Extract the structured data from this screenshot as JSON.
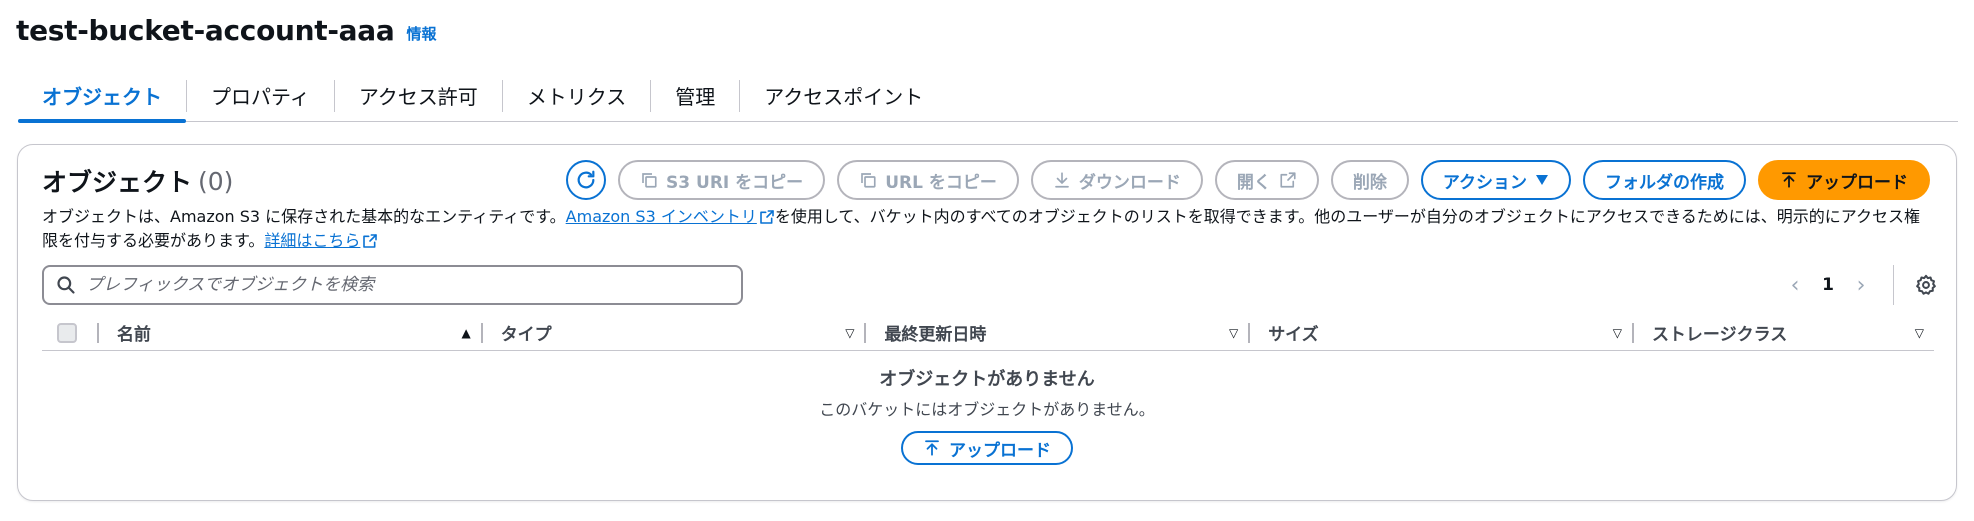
{
  "header": {
    "bucket_name": "test-bucket-account-aaa",
    "info_label": "情報"
  },
  "tabs": [
    {
      "label": "オブジェクト",
      "active": true
    },
    {
      "label": "プロパティ",
      "active": false
    },
    {
      "label": "アクセス許可",
      "active": false
    },
    {
      "label": "メトリクス",
      "active": false
    },
    {
      "label": "管理",
      "active": false
    },
    {
      "label": "アクセスポイント",
      "active": false
    }
  ],
  "panel": {
    "title": "オブジェクト",
    "count": "(0)",
    "actions": {
      "refresh_icon": "refresh-icon",
      "copy_s3_uri": "S3 URI をコピー",
      "copy_url": "URL をコピー",
      "download": "ダウンロード",
      "open": "開く",
      "delete": "削除",
      "actions": "アクション",
      "create_folder": "フォルダの作成",
      "upload": "アップロード"
    },
    "description": {
      "part1": "オブジェクトは、Amazon S3 に保存された基本的なエンティティです。",
      "link1": "Amazon S3 インベントリ",
      "part2": "を使用して、バケット内のすべてのオブジェクトのリストを取得できます。他のユーザーが自分のオブジェクトにアクセスできるためには、明示的にアクセス権限を付与する必要があります。",
      "link2": "詳細はこちら"
    },
    "search": {
      "placeholder": "プレフィックスでオブジェクトを検索",
      "value": ""
    },
    "pagination": {
      "current_page": "1"
    },
    "table": {
      "columns": [
        {
          "label": "名前",
          "sort": "ascending"
        },
        {
          "label": "タイプ",
          "sort": "none"
        },
        {
          "label": "最終更新日時",
          "sort": "none"
        },
        {
          "label": "サイズ",
          "sort": "none"
        },
        {
          "label": "ストレージクラス",
          "sort": "none"
        }
      ],
      "rows": []
    },
    "empty_state": {
      "title": "オブジェクトがありません",
      "description": "このバケットにはオブジェクトがありません。",
      "button": "アップロード"
    }
  },
  "colors": {
    "accent": "#0972d3",
    "primary_button": "#ff9900",
    "disabled_text": "#9ba7b6",
    "border": "#c6c6cd"
  }
}
